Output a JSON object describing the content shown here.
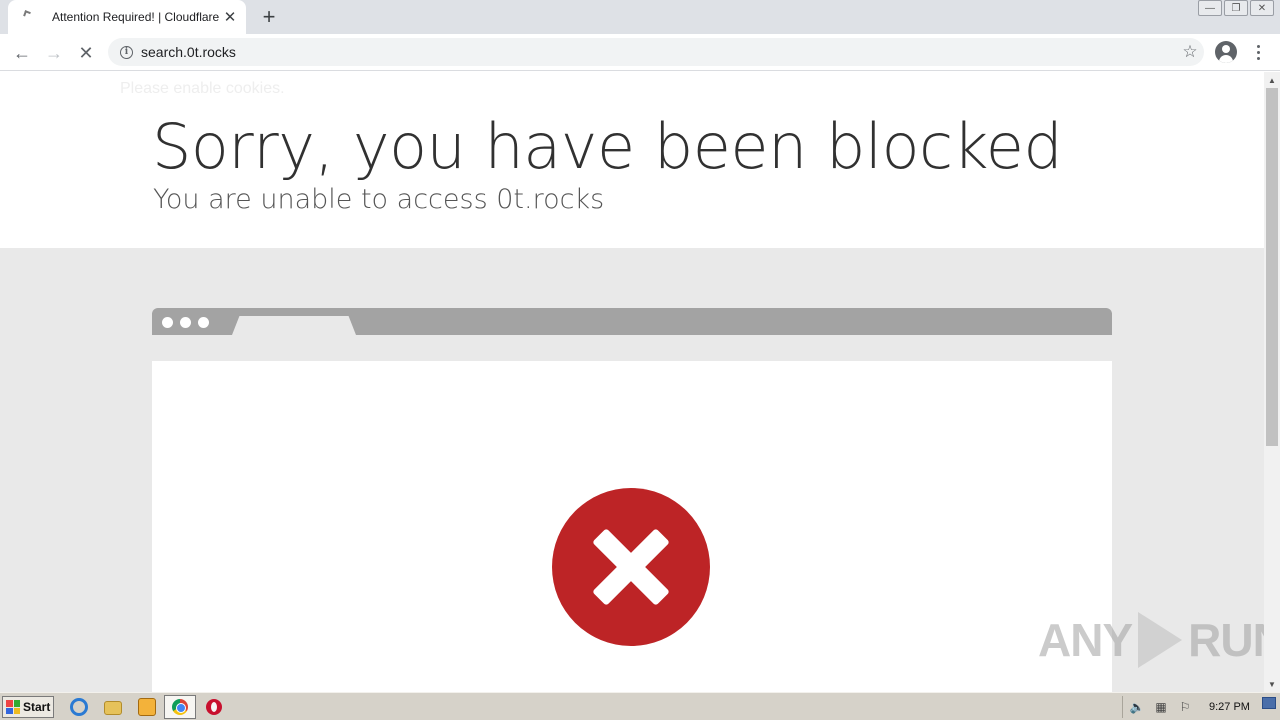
{
  "browser": {
    "tab_title": "Attention Required! | Cloudflare",
    "tab_close": "✕",
    "new_tab": "+",
    "url": "search.0t.rocks",
    "back": "←",
    "forward": "→",
    "stop": "✕",
    "bookmark_star": "☆",
    "window_minimize": "—",
    "window_restore": "❐",
    "window_close": "✕"
  },
  "page": {
    "ghost_text": "Please enable cookies.",
    "headline": "Sorry, you have been blocked",
    "subhead": "You are unable to access 0t.rocks",
    "error_icon": "error-x-icon",
    "accent_color": "#bd2426"
  },
  "watermark": {
    "left": "ANY",
    "right": "RUN"
  },
  "taskbar": {
    "start_label": "Start",
    "clock": "9:27 PM"
  }
}
